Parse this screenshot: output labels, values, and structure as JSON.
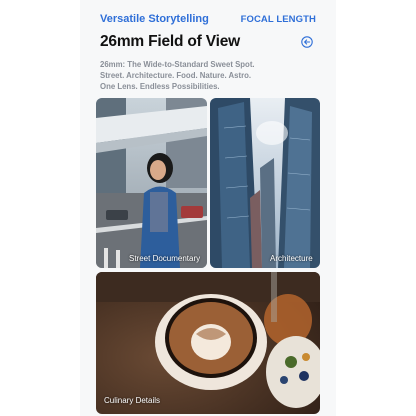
{
  "header": {
    "brand": "Versatile Storytelling",
    "section": "FOCAL LENGTH"
  },
  "title": "26mm Field of View",
  "description": {
    "lines": [
      "26mm: The Wide-to-Standard Sweet Spot.",
      "Street. Architecture. Food. Nature. Astro.",
      "One Lens. Endless Possibilities."
    ]
  },
  "gallery": {
    "items": [
      {
        "caption": "Street Documentary"
      },
      {
        "caption": "Architecture"
      },
      {
        "caption": "Culinary Details"
      }
    ]
  },
  "colors": {
    "accent": "#2f6fd8",
    "panel_bg": "#f7f8f9",
    "desc_text": "#8a8f98"
  },
  "icons": {
    "back": "back-arrow-circle-icon"
  }
}
